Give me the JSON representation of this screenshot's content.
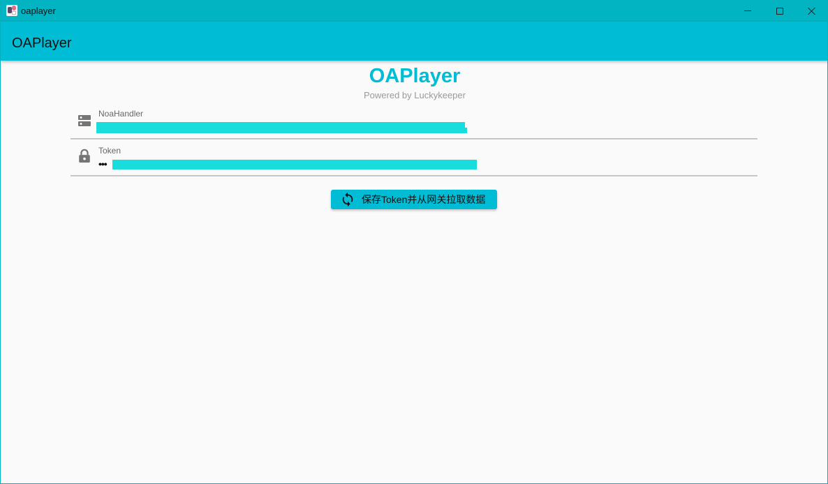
{
  "window": {
    "title": "oaplayer",
    "app_icon": "oaplayer-app-icon",
    "controls": [
      "minimize-icon",
      "maximize-icon",
      "close-icon"
    ]
  },
  "appbar": {
    "title": "OAPlayer"
  },
  "brand": {
    "title": "OAPlayer",
    "subtitle": "Powered by Luckykeeper"
  },
  "form": {
    "noa_handler": {
      "label": "NoaHandler",
      "icon": "server-icon",
      "value_redacted": true
    },
    "token": {
      "label": "Token",
      "icon": "lock-icon",
      "masked_prefix": "•••",
      "value_redacted": true
    }
  },
  "actions": {
    "save_button": {
      "label": "保存Token并从网关拉取数据",
      "icon": "sync-icon"
    }
  },
  "colors": {
    "primary": "#00bcd4",
    "titlebar": "#02b3c1",
    "redaction": "#19dcdc",
    "background": "#fafafa"
  }
}
